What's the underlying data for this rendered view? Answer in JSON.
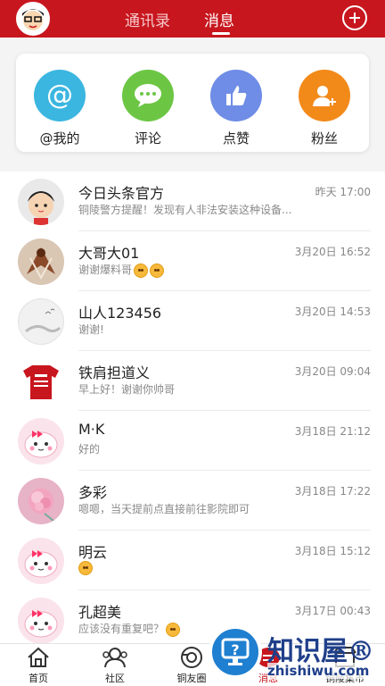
{
  "header": {
    "tabs": [
      {
        "label": "通讯录",
        "active": false
      },
      {
        "label": "消息",
        "active": true
      }
    ],
    "add_icon": "plus-circle-icon",
    "colors": {
      "brand": "#c8161e"
    }
  },
  "actions": [
    {
      "label": "@我的",
      "icon": "at-sign-icon",
      "color": "#3bb6e0"
    },
    {
      "label": "评论",
      "icon": "chat-bubble-icon",
      "color": "#6cc644"
    },
    {
      "label": "点赞",
      "icon": "thumbs-up-icon",
      "color": "#6f8de6"
    },
    {
      "label": "粉丝",
      "icon": "add-person-icon",
      "color": "#f28a1a"
    }
  ],
  "messages": [
    {
      "name": "今日头条官方",
      "preview": "铜陵警方提醒！发现有人非法安装这种设备...",
      "time": "昨天 17:00",
      "emojis": 0
    },
    {
      "name": "大哥大01",
      "preview": "谢谢爆料哥",
      "time": "3月20日 16:52",
      "emojis": 2
    },
    {
      "name": "山人123456",
      "preview": "谢谢!",
      "time": "3月20日 14:53",
      "emojis": 0
    },
    {
      "name": "铁肩担道义",
      "preview": "早上好！谢谢你帅哥",
      "time": "3月20日 09:04",
      "emojis": 0
    },
    {
      "name": "M·K",
      "preview": "好的",
      "time": "3月18日 21:12",
      "emojis": 0
    },
    {
      "name": "多彩",
      "preview": "嗯嗯，当天提前点直接前往影院即可",
      "time": "3月18日 17:22",
      "emojis": 0
    },
    {
      "name": "明云",
      "preview": "",
      "time": "3月18日 15:12",
      "emojis": 1
    },
    {
      "name": "孔超美",
      "preview": "应该没有重复吧？",
      "time": "3月17日 00:43",
      "emojis": 1
    }
  ],
  "bottom_nav": [
    {
      "label": "首页",
      "icon": "home-icon",
      "active": false
    },
    {
      "label": "社区",
      "icon": "community-icon",
      "active": false
    },
    {
      "label": "铜友圈",
      "icon": "camera-circle-icon",
      "active": false
    },
    {
      "label": "消息",
      "icon": "message-icon",
      "active": true
    },
    {
      "label": "铜陵集市",
      "icon": "market-icon",
      "active": false
    }
  ],
  "watermark": {
    "title": "知识屋®",
    "url": "zhishiwu.com"
  }
}
